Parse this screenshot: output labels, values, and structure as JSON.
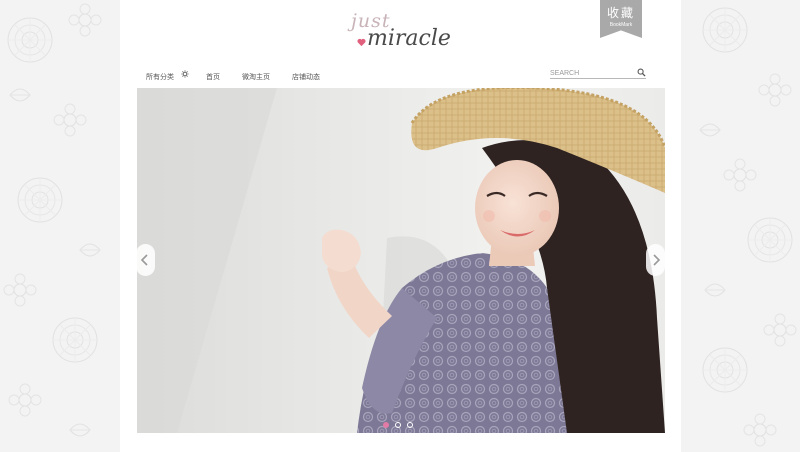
{
  "logo": {
    "line1": "just",
    "line2": "miracle",
    "heart_color": "#e0607e"
  },
  "bookmark": {
    "label_cn": "收藏",
    "label_en": "BookMark"
  },
  "nav": {
    "items": [
      {
        "label": "所有分类"
      },
      {
        "label": "首页"
      },
      {
        "label": "微淘主页"
      },
      {
        "label": "店铺动态"
      }
    ],
    "gear_icon": "gear-icon"
  },
  "search": {
    "placeholder": "SEARCH",
    "icon": "search-icon"
  },
  "carousel": {
    "slide_count": 3,
    "active_index": 0,
    "prev_icon": "chevron-left-icon",
    "next_icon": "chevron-right-icon",
    "active_dot_color": "#e27ba6"
  }
}
